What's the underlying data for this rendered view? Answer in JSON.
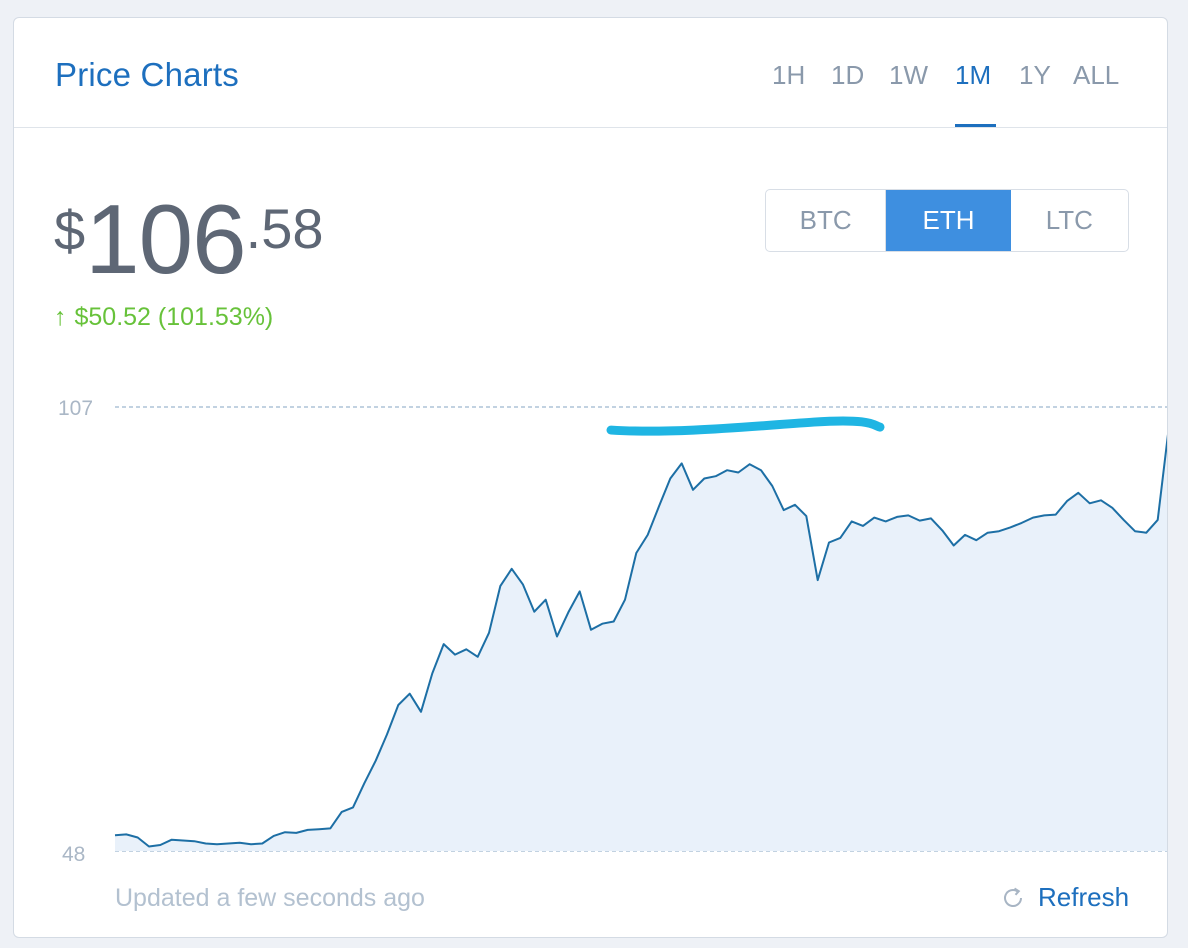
{
  "card": {
    "title": "Price Charts"
  },
  "ranges": [
    "1H",
    "1D",
    "1W",
    "1M",
    "1Y",
    "ALL"
  ],
  "active_range": "1M",
  "currencies": [
    "BTC",
    "ETH",
    "LTC"
  ],
  "active_currency": "ETH",
  "price": {
    "symbol": "$",
    "integer": "106",
    "decimal": ".58"
  },
  "change": {
    "arrow": "↑",
    "text": "$50.52 (101.53%)"
  },
  "footer": {
    "updated": "Updated a few seconds ago",
    "refresh_label": "Refresh",
    "refresh_icon": "refresh-icon"
  },
  "colors": {
    "accent": "#1d6fbe",
    "active_button": "#3e8fe0",
    "positive": "#67c23a",
    "line": "#1d6fa5",
    "area_fill": "#e9f1fa",
    "highlight_stroke": "#1fb5e3"
  },
  "chart_data": {
    "type": "area",
    "title": "",
    "xlabel": "",
    "ylabel": "",
    "ylim": [
      48,
      107
    ],
    "y_ticks": [
      107,
      48
    ],
    "gridlines": "dashed horizontal at 107 and 48",
    "x": [
      0,
      2,
      4,
      6,
      8,
      10,
      12,
      14,
      16,
      18,
      20,
      22,
      24,
      26,
      28,
      30,
      32,
      34,
      36,
      38,
      40,
      42,
      44,
      46,
      48,
      50,
      52,
      54,
      56,
      58,
      60,
      62,
      64,
      66,
      68,
      70,
      72,
      74,
      76,
      78,
      80,
      82,
      84,
      86,
      88,
      90,
      92,
      94,
      96,
      98,
      100,
      102,
      104,
      106,
      108,
      110,
      112,
      114,
      116,
      118,
      120,
      122,
      124,
      126,
      128,
      130,
      132,
      134,
      136,
      138,
      140,
      142,
      144,
      146,
      148,
      150,
      152,
      154,
      156,
      158,
      160,
      162,
      164,
      166,
      168,
      170,
      172,
      174,
      176,
      178,
      180,
      182,
      184,
      186,
      188,
      190,
      192,
      194,
      196,
      198,
      200,
      202,
      204,
      206,
      208,
      210,
      212,
      214,
      216,
      218,
      220,
      222,
      224,
      226,
      228,
      230,
      232,
      234,
      236,
      238,
      240,
      242,
      244,
      246,
      248,
      250,
      252,
      254,
      256,
      258,
      260,
      262,
      264,
      266,
      268,
      270,
      272,
      274,
      276,
      278,
      280,
      282,
      284,
      286,
      288,
      290,
      292,
      294,
      296,
      298,
      300
    ],
    "series": [
      {
        "values": [
          50.1,
          50.2,
          49.8,
          48.6,
          48.8,
          49.5,
          49.4,
          49.3,
          49.0,
          48.9,
          49.0,
          49.1,
          48.9,
          49.0,
          50.0,
          50.5,
          50.4,
          50.8,
          50.9,
          51.0,
          53.2,
          53.8,
          57.0,
          60.0,
          63.5,
          67.4,
          68.9,
          66.5,
          71.6,
          75.5,
          74.1,
          74.8,
          73.8,
          77.0,
          83.2,
          85.5,
          83.4,
          79.8,
          81.4,
          76.5,
          79.7,
          82.5,
          77.4,
          78.2,
          78.5,
          81.4,
          87.6,
          90.0,
          93.8,
          97.5,
          99.5,
          96.0,
          97.5,
          97.8,
          98.6,
          98.3,
          99.4,
          98.6,
          96.5,
          93.3,
          94.0,
          92.5,
          84.0,
          89.0,
          89.6,
          91.8,
          91.2,
          92.3,
          91.8,
          92.4,
          92.6,
          91.9,
          92.2,
          90.6,
          88.6,
          90.0,
          89.3,
          90.3,
          90.5,
          91.0,
          91.6,
          92.3,
          92.6,
          92.7,
          94.5,
          95.6,
          94.2,
          94.6,
          93.6,
          92.0,
          90.5,
          90.3,
          92.0,
          104.5
        ],
        "smoothing_note": ""
      }
    ],
    "annotations": [
      "hand-drawn highlight stroke near the peak around 104"
    ],
    "legend": "none"
  }
}
